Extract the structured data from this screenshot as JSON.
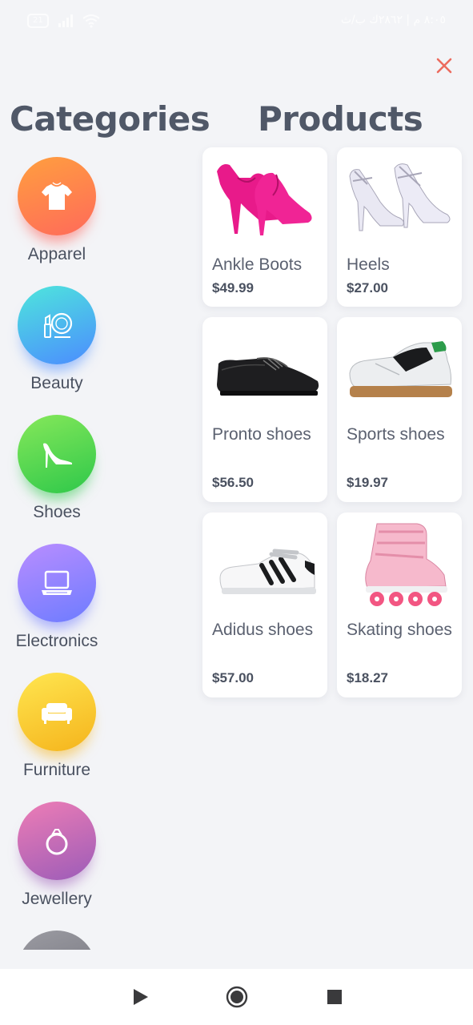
{
  "status_bar": {
    "battery": "21",
    "right_text": "٨:٠٥ م | ٢٨٦٢ك ب/ث"
  },
  "headings": {
    "categories": "Categories",
    "products": "Products"
  },
  "categories": [
    {
      "label": "Apparel",
      "icon": "tshirt-icon",
      "color_top": "#ff9a3c",
      "color_bottom": "#ff5f5f"
    },
    {
      "label": "Beauty",
      "icon": "cosmetics-icon",
      "color_top": "#4fe3e0",
      "color_bottom": "#4b8cff"
    },
    {
      "label": "Shoes",
      "icon": "high-heel-icon",
      "color_top": "#7ee655",
      "color_bottom": "#2ccb4a"
    },
    {
      "label": "Electronics",
      "icon": "laptop-icon",
      "color_top": "#b48cff",
      "color_bottom": "#6f78ff"
    },
    {
      "label": "Furniture",
      "icon": "sofa-icon",
      "color_top": "#ffe24d",
      "color_bottom": "#f8b81f"
    },
    {
      "label": "Jewellery",
      "icon": "ring-icon",
      "color_top": "#e87ab8",
      "color_bottom": "#a05bb6"
    }
  ],
  "products": [
    {
      "name": "Ankle Boots",
      "price": "$49.99",
      "image": "pink-ankle-boots"
    },
    {
      "name": "Heels",
      "price": "$27.00",
      "image": "white-strappy-heels"
    },
    {
      "name": "Pronto shoes",
      "price": "$56.50",
      "image": "black-oxford-shoes"
    },
    {
      "name": "Sports shoes",
      "price": "$19.97",
      "image": "white-sports-sneakers"
    },
    {
      "name": "Adidus shoes",
      "price": "$57.00",
      "image": "white-striped-sneakers"
    },
    {
      "name": "Skating shoes",
      "price": "$18.27",
      "image": "pink-inline-skates"
    }
  ],
  "colors": {
    "background": "#f3f4f7",
    "close": "#ec6b5e",
    "text": "#4a5160"
  }
}
